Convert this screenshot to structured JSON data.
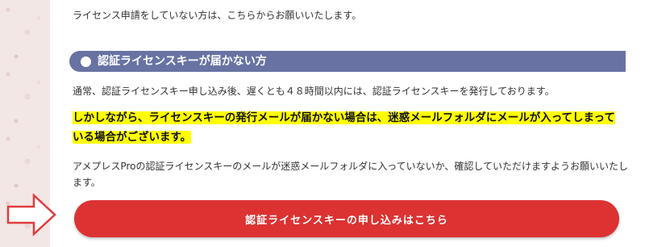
{
  "intro_text": "ライセンス申請をしていない方は、こちらからお願いいたします。",
  "section": {
    "heading": "認証ライセンスキーが届かない方",
    "paragraph1": "通常、認証ライセンスキー申し込み後、遅くとも４８時間以内には、認証ライセンスキーを発行しております。",
    "emphasis": "しかしながら、ライセンスキーの発行メールが届かない場合は、迷惑メールフォルダにメールが入ってしまっている場合がございます。",
    "paragraph2": "アメプレスProの認証ライセンスキーのメールが迷惑メールフォルダに入っていないか、確認していただけますようお願いいたします。"
  },
  "cta_button": "認証ライセンスキーの申し込みはこちら",
  "icons": {
    "arrow": "right-arrow-outline-icon",
    "bullet": "white-circle"
  },
  "colors": {
    "heading_bg": "#6873a3",
    "button_bg": "#dc3232",
    "highlight": "#ffff00",
    "arrow_stroke": "#e03c3c"
  }
}
